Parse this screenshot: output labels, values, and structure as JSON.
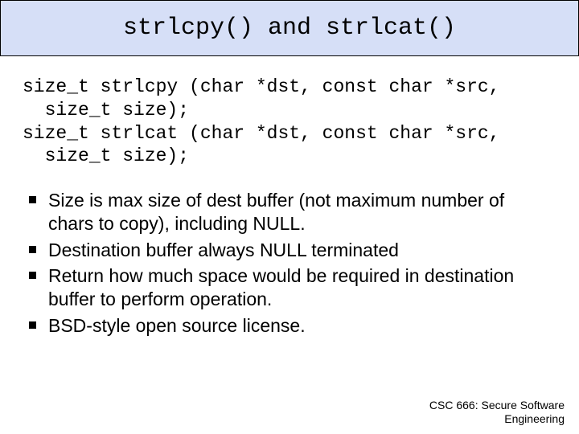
{
  "title": "strlcpy() and strlcat()",
  "code": "size_t strlcpy (char *dst, const char *src,\n  size_t size);\nsize_t strlcat (char *dst, const char *src,\n  size_t size);",
  "bullets": [
    "Size is max size of dest buffer (not maximum number of chars to copy), including NULL.",
    "Destination buffer always NULL terminated",
    "Return how much space would be required in destination buffer to perform operation.",
    "BSD-style open source license."
  ],
  "footer_line1": "CSC 666: Secure Software",
  "footer_line2": "Engineering"
}
